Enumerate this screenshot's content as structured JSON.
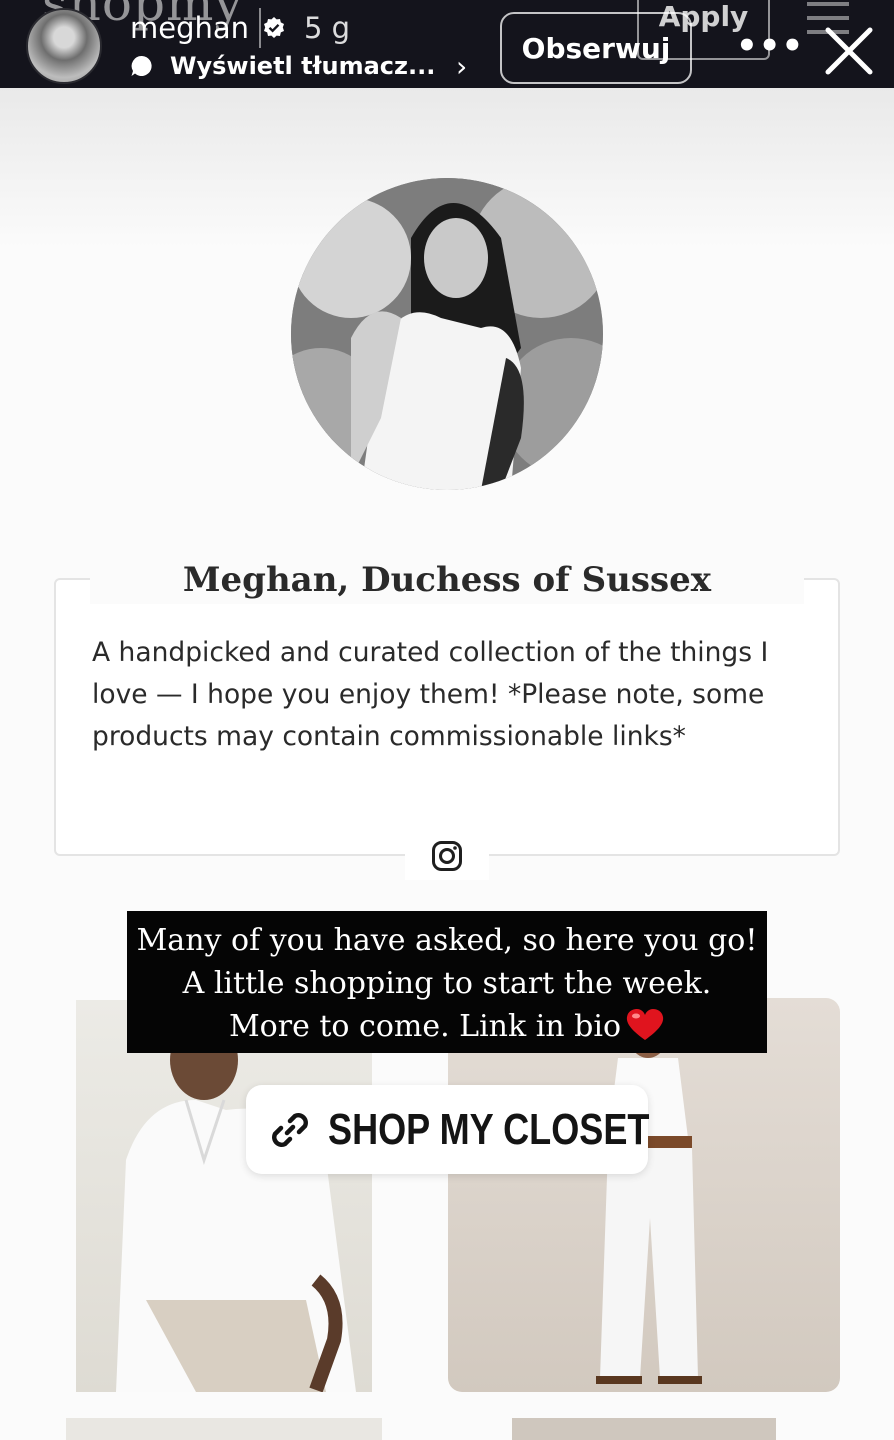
{
  "story_header": {
    "username": "meghan",
    "time_ago": "5 g",
    "translate_label": "Wyświetl tłumacz...",
    "follow_label": "Obserwuj",
    "more_label": "•••",
    "background_logo": "shopmy",
    "background_apply": "Apply"
  },
  "profile": {
    "name": "Meghan, Duchess of Sussex",
    "bio": "A handpicked and curated collection of the things I love — I hope you enjoy them! *Please note, some products may contain commissionable links*",
    "social_icon": "instagram-icon"
  },
  "story_caption": {
    "lines": [
      "Many of you have asked, so here you go!",
      "A little shopping to start the week.",
      "More to come. Link in bio"
    ],
    "emoji": "heart-emoji"
  },
  "link_sticker": {
    "label": "SHOP MY CLOSET",
    "icon": "link-icon"
  },
  "colors": {
    "story_bar": "#14141c",
    "caption_bg": "#050505",
    "heart": "#e0141e"
  }
}
